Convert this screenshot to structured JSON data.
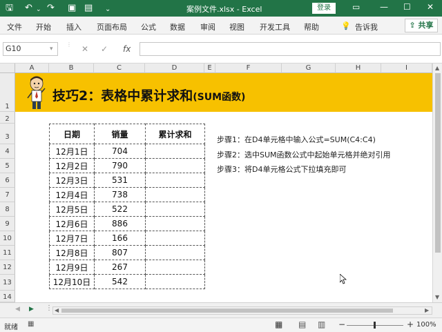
{
  "titlebar": {
    "title": "案例文件.xlsx  -  Excel",
    "login": "登录",
    "minimize": "—",
    "restore": "☐",
    "close": "✕"
  },
  "ribbon": {
    "tabs": [
      "文件",
      "开始",
      "插入",
      "页面布局",
      "公式",
      "数据",
      "审阅",
      "视图",
      "开发工具",
      "帮助"
    ],
    "tell_me": "告诉我",
    "share": "共享"
  },
  "formula_bar": {
    "name_box": "G10",
    "fx": "fx"
  },
  "columns": [
    "A",
    "B",
    "C",
    "D",
    "E",
    "F",
    "G",
    "H",
    "I"
  ],
  "rows": [
    "1",
    "2",
    "3",
    "4",
    "5",
    "6",
    "7",
    "8",
    "9",
    "10",
    "11",
    "12",
    "13",
    "14"
  ],
  "banner": {
    "title": "技巧2：表格中累计求和",
    "subtitle": "(SUM函数)"
  },
  "table": {
    "headers": [
      "日期",
      "销量",
      "累计求和"
    ],
    "rows": [
      [
        "12月1日",
        "704",
        ""
      ],
      [
        "12月2日",
        "790",
        ""
      ],
      [
        "12月3日",
        "531",
        ""
      ],
      [
        "12月4日",
        "738",
        ""
      ],
      [
        "12月5日",
        "522",
        ""
      ],
      [
        "12月6日",
        "886",
        ""
      ],
      [
        "12月7日",
        "166",
        ""
      ],
      [
        "12月8日",
        "807",
        ""
      ],
      [
        "12月9日",
        "267",
        ""
      ],
      [
        "12月10日",
        "542",
        ""
      ]
    ]
  },
  "steps": [
    "步骤1：在D4单元格中输入公式=SUM(C4:C4)",
    "步骤2：选中SUM函数公式中起始单元格并绝对引用",
    "步骤3：将D4单元格公式下拉填充即可"
  ],
  "status": {
    "ready": "就绪",
    "zoom": "100%",
    "minus": "−",
    "plus": "+"
  },
  "colors": {
    "excel_green": "#227447",
    "banner": "#f7c100"
  }
}
